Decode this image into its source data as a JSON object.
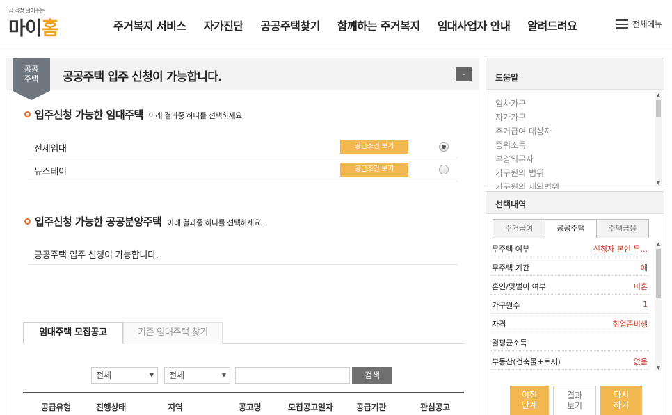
{
  "logo": {
    "tagline": "집 걱정 덜어주는",
    "name_prefix": "마이",
    "name_accent": "홈"
  },
  "nav": {
    "items": [
      "주거복지 서비스",
      "자가진단",
      "공공주택찾기",
      "함께하는 주거복지",
      "임대사업자 안내",
      "알려드려요"
    ],
    "all_menu": "전체메뉴"
  },
  "panel": {
    "ribbon": "공공\n주택",
    "title": "공공주택 입주 신청이 가능합니다.",
    "collapse_label": "-"
  },
  "rental_section": {
    "title": "입주신청 가능한 임대주택",
    "subtitle": "아래 결과중 하나를 선택하세요.",
    "options": [
      {
        "label": "전세임대",
        "button": "공급조건 보기",
        "selected": true
      },
      {
        "label": "뉴스테이",
        "button": "공급조건 보기",
        "selected": false
      }
    ]
  },
  "sale_section": {
    "title": "입주신청 가능한 공공분양주택",
    "subtitle": "아래 결과중 하나를 선택하세요.",
    "message": "공공주택 입주 신청이 가능합니다."
  },
  "listing_tabs": [
    "임대주택 모집공고",
    "기존 임대주택 찾기"
  ],
  "filters": {
    "select1": "전체",
    "select2": "전체",
    "search_value": "",
    "search_button": "검색"
  },
  "table_headers": [
    "공급유형",
    "진행상태",
    "지역",
    "공고명",
    "모집공고일자",
    "공급기관",
    "관심공고"
  ],
  "help": {
    "title": "도움말",
    "items": [
      "임차가구",
      "자가가구",
      "주거급여 대상자",
      "중위소득",
      "부양의무자",
      "가구원의 범위",
      "가구원의 제외범위"
    ]
  },
  "selection": {
    "title": "선택내역",
    "tabs": [
      "주거급여",
      "공공주택",
      "주택금융"
    ],
    "active_tab": "공공주택",
    "rows": [
      {
        "key": "무주택 여부",
        "value": "신청자 본인 무..."
      },
      {
        "key": "무주택 기간",
        "value": "예"
      },
      {
        "key": "혼인/맞벌이 여부",
        "value": "미혼"
      },
      {
        "key": "가구원수",
        "value": "1"
      },
      {
        "key": "자격",
        "value": "취업준비생"
      },
      {
        "key": "월평균소득",
        "value": ""
      },
      {
        "key": "부동산(건축물+토지)",
        "value": "없음"
      }
    ]
  },
  "actions": {
    "prev": "이전\n단계",
    "result": "결과\n보기",
    "again": "다시\n하기"
  },
  "colors": {
    "accent_orange": "#f2b84f",
    "bullet_orange": "#e8702a",
    "value_red": "#c0392b",
    "ribbon_gray": "#6e7780"
  }
}
